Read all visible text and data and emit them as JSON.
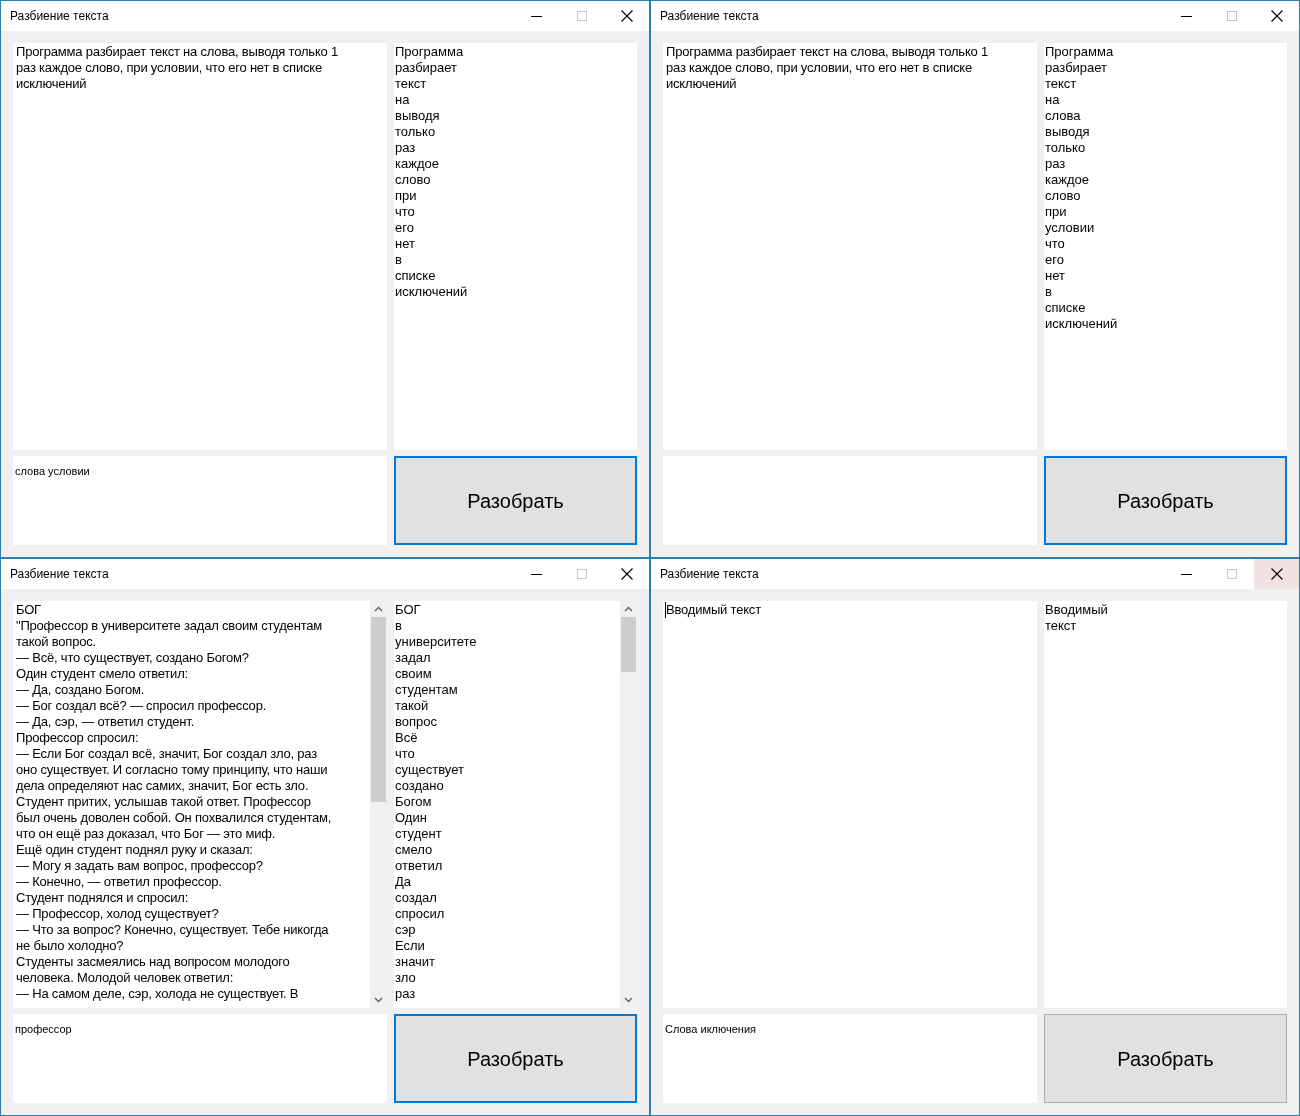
{
  "windows": [
    {
      "title": "Разбиение текста",
      "close_hovered": false,
      "input": {
        "text": "Программа разбирает текст на слова, выводя только 1\nраз каждое слово, при условии, что его нет в списке\nисключений",
        "scrollable": false,
        "focused": false
      },
      "output": {
        "words": [
          "Программа",
          "разбирает",
          "текст",
          "на",
          "выводя",
          "только",
          "раз",
          "каждое",
          "слово",
          "при",
          "что",
          "его",
          "нет",
          "в",
          "списке",
          "исключений"
        ],
        "scrollable": false
      },
      "exclusions": "слова условии",
      "button": {
        "label": "Разобрать",
        "focused": true
      }
    },
    {
      "title": "Разбиение текста",
      "close_hovered": false,
      "input": {
        "text": "Программа разбирает текст на слова, выводя только 1\nраз каждое слово, при условии, что его нет в списке\nисключений",
        "scrollable": false,
        "focused": false
      },
      "output": {
        "words": [
          "Программа",
          "разбирает",
          "текст",
          "на",
          "слова",
          "выводя",
          "только",
          "раз",
          "каждое",
          "слово",
          "при",
          "условии",
          "что",
          "его",
          "нет",
          "в",
          "списке",
          "исключений"
        ],
        "scrollable": false
      },
      "button": {
        "label": "Разобрать",
        "focused": true
      }
    },
    {
      "title": "Разбиение текста",
      "close_hovered": false,
      "input": {
        "text": "БОГ\n\"Профессор в университете задал своим студентам\nтакой вопрос.\n— Всё, что существует, создано Богом?\nОдин студент смело ответил:\n— Да, создано Богом.\n— Бог создал всё? — спросил профессор.\n— Да, сэр, — ответил студент.\nПрофессор спросил:\n— Если Бог создал всё, значит, Бог создал зло, раз\nоно существует. И согласно тому принципу, что наши\nдела определяют нас самих, значит, Бог есть зло.\nСтудент притих, услышав такой ответ. Профессор\nбыл очень доволен собой. Он похвалился студентам,\nчто он ещё раз доказал, что Бог — это миф.\nЕщё один студент поднял руку и сказал:\n— Могу я задать вам вопрос, профессор?\n— Конечно, — ответил профессор.\nСтудент поднялся и спросил:\n— Профессор, холод существует?\n— Что за вопрос? Конечно, существует. Тебе никогда\nне было холодно?\nСтуденты засмеялись над вопросом молодого\nчеловека. Молодой человек ответил:\n— На самом деле, сэр, холода не существует. В",
        "scrollable": true,
        "focused": false
      },
      "output": {
        "words": [
          "БОГ",
          "в",
          "университете",
          "задал",
          "своим",
          "студентам",
          "такой",
          "вопрос",
          "Всё",
          "что",
          "существует",
          "создано",
          "Богом",
          "Один",
          "студент",
          "смело",
          "ответил",
          "Да",
          "создал",
          "спросил",
          "сэр",
          "Если",
          "значит",
          "зло",
          "раз"
        ],
        "scrollable": true
      },
      "exclusions": "профессор",
      "button": {
        "label": "Разобрать",
        "focused": true
      }
    },
    {
      "title": "Разбиение текста",
      "close_hovered": true,
      "input": {
        "text": "Вводимый текст",
        "scrollable": false,
        "focused": true
      },
      "output": {
        "words": [
          "Вводимый",
          "текст"
        ],
        "scrollable": false
      },
      "exclusions": "Слова иключения",
      "button": {
        "label": "Разобрать",
        "focused": false
      }
    }
  ]
}
